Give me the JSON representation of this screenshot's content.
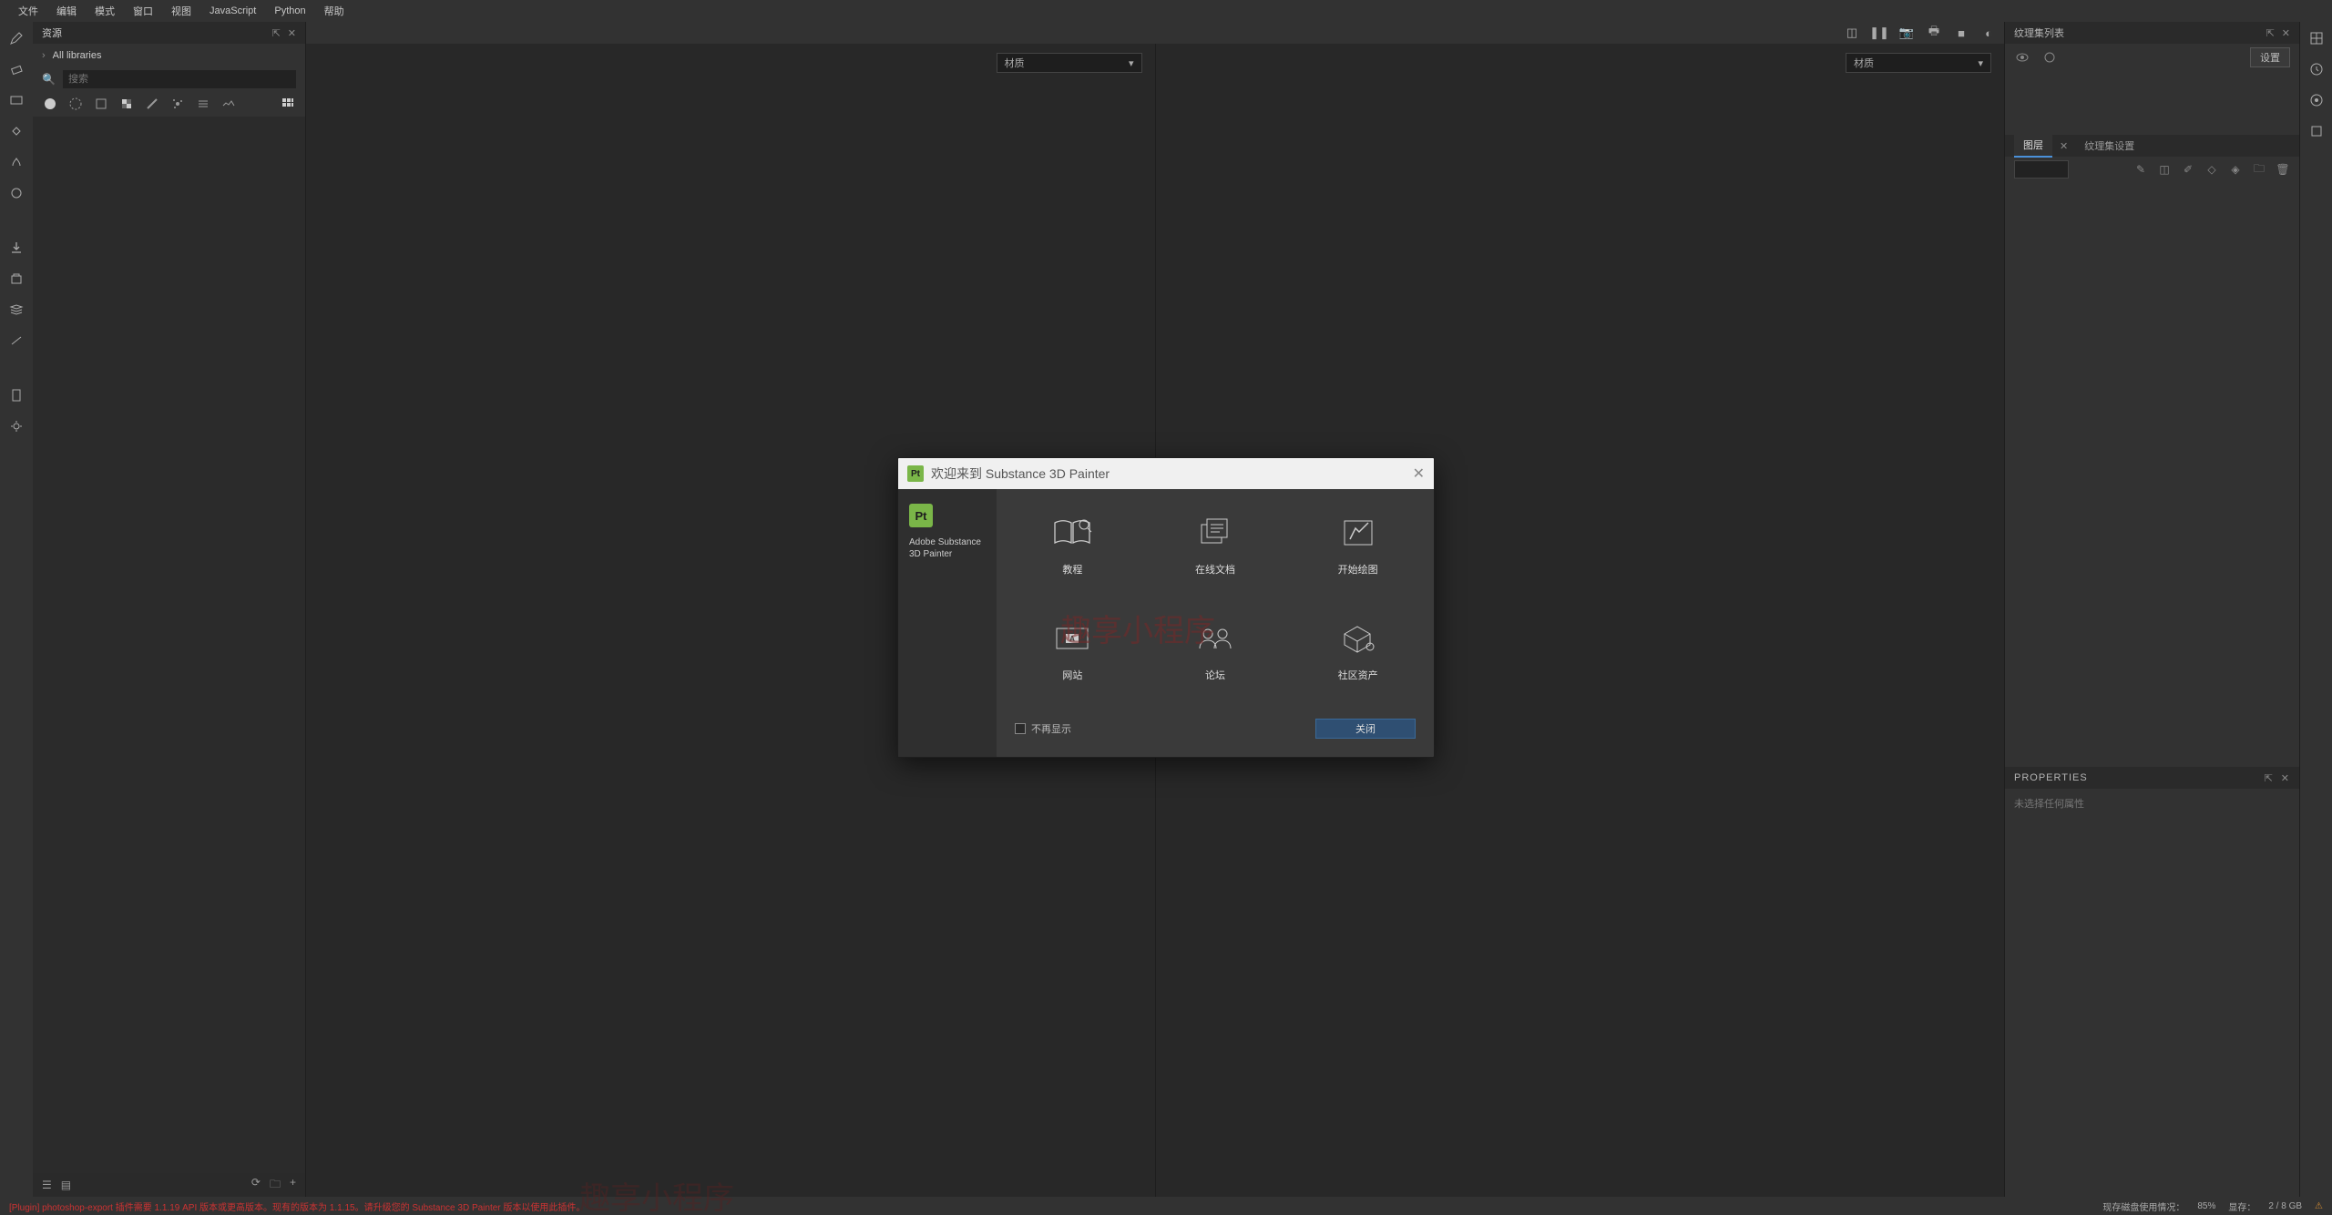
{
  "menu": {
    "items": [
      "文件",
      "编辑",
      "模式",
      "窗口",
      "视图",
      "JavaScript",
      "Python",
      "帮助"
    ]
  },
  "left_panel": {
    "tab": "资源",
    "all_libs": "All libraries",
    "search_placeholder": "搜索"
  },
  "viewport": {
    "dropdown": "材质"
  },
  "right_panel": {
    "top_title": "纹理集列表",
    "settings_btn": "设置",
    "tabs": {
      "t1": "图层",
      "t2": "纹理集设置"
    },
    "properties": "PROPERTIES",
    "prop_msg": "未选择任何属性"
  },
  "modal": {
    "title": "欢迎来到 Substance 3D Painter",
    "pt": "Pt",
    "side_text": "Adobe Substance 3D Painter",
    "cards": {
      "c1": "教程",
      "c2": "在线文档",
      "c3": "开始绘图",
      "c4": "网站",
      "c5": "论坛",
      "c6": "社区资产"
    },
    "dont_show": "不再显示",
    "close": "关闭"
  },
  "watermark": "趣享小程序",
  "status": {
    "err": "[Plugin] photoshop-export 插件需要 1.1.19 API 版本或更高版本。现有的版本为 1.1.15。请升级您的 Substance 3D Painter 版本以使用此插件。",
    "disk": "现存磁盘使用情况：",
    "pct": "85%",
    "vram": "显存：",
    "gb": "2 / 8 GB"
  }
}
